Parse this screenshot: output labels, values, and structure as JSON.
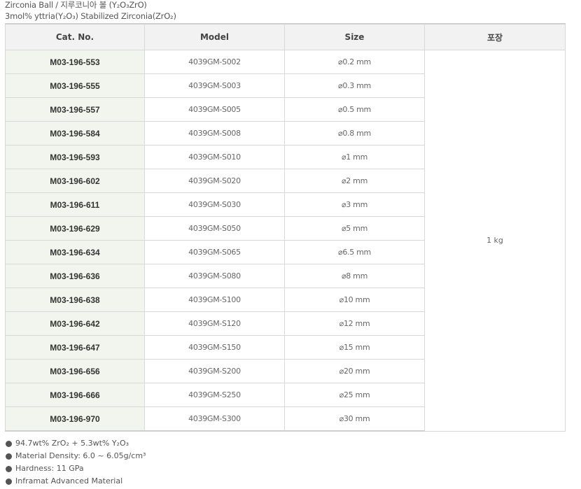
{
  "header": {
    "line1": "Zirconia Ball / 지루코니아 볼 (Y₂O₃ZrO)",
    "line2": "3mol% yttria(Y₂O₃) Stabilized Zirconia(ZrO₂)"
  },
  "table": {
    "columns": [
      "Cat. No.",
      "Model",
      "Size",
      "포장"
    ],
    "packaging": "1 kg",
    "rows": [
      {
        "cat": "M03-196-553",
        "model": "4039GM-S002",
        "size": "⌀0.2 mm"
      },
      {
        "cat": "M03-196-555",
        "model": "4039GM-S003",
        "size": "⌀0.3 mm"
      },
      {
        "cat": "M03-196-557",
        "model": "4039GM-S005",
        "size": "⌀0.5 mm"
      },
      {
        "cat": "M03-196-584",
        "model": "4039GM-S008",
        "size": "⌀0.8 mm"
      },
      {
        "cat": "M03-196-593",
        "model": "4039GM-S010",
        "size": "⌀1 mm"
      },
      {
        "cat": "M03-196-602",
        "model": "4039GM-S020",
        "size": "⌀2 mm"
      },
      {
        "cat": "M03-196-611",
        "model": "4039GM-S030",
        "size": "⌀3 mm"
      },
      {
        "cat": "M03-196-629",
        "model": "4039GM-S050",
        "size": "⌀5 mm"
      },
      {
        "cat": "M03-196-634",
        "model": "4039GM-S065",
        "size": "⌀6.5 mm"
      },
      {
        "cat": "M03-196-636",
        "model": "4039GM-S080",
        "size": "⌀8 mm"
      },
      {
        "cat": "M03-196-638",
        "model": "4039GM-S100",
        "size": "⌀10 mm"
      },
      {
        "cat": "M03-196-642",
        "model": "4039GM-S120",
        "size": "⌀12 mm"
      },
      {
        "cat": "M03-196-647",
        "model": "4039GM-S150",
        "size": "⌀15 mm"
      },
      {
        "cat": "M03-196-656",
        "model": "4039GM-S200",
        "size": "⌀20 mm"
      },
      {
        "cat": "M03-196-666",
        "model": "4039GM-S250",
        "size": "⌀25 mm"
      },
      {
        "cat": "M03-196-970",
        "model": "4039GM-S300",
        "size": "⌀30 mm"
      }
    ]
  },
  "notes": [
    "94.7wt% ZrO₂ + 5.3wt% Y₂O₃",
    "Material Density: 6.0 ~ 6.05g/cm³",
    "Hardness: 11 GPa",
    "Inframat Advanced Material"
  ],
  "colors": {
    "cat_cell_bg": "#f2f5ee",
    "header_bg": "#f2f2f2",
    "border": "#d8d8d8"
  },
  "icons": {
    "note_bullet": "bullet-dot-icon"
  }
}
